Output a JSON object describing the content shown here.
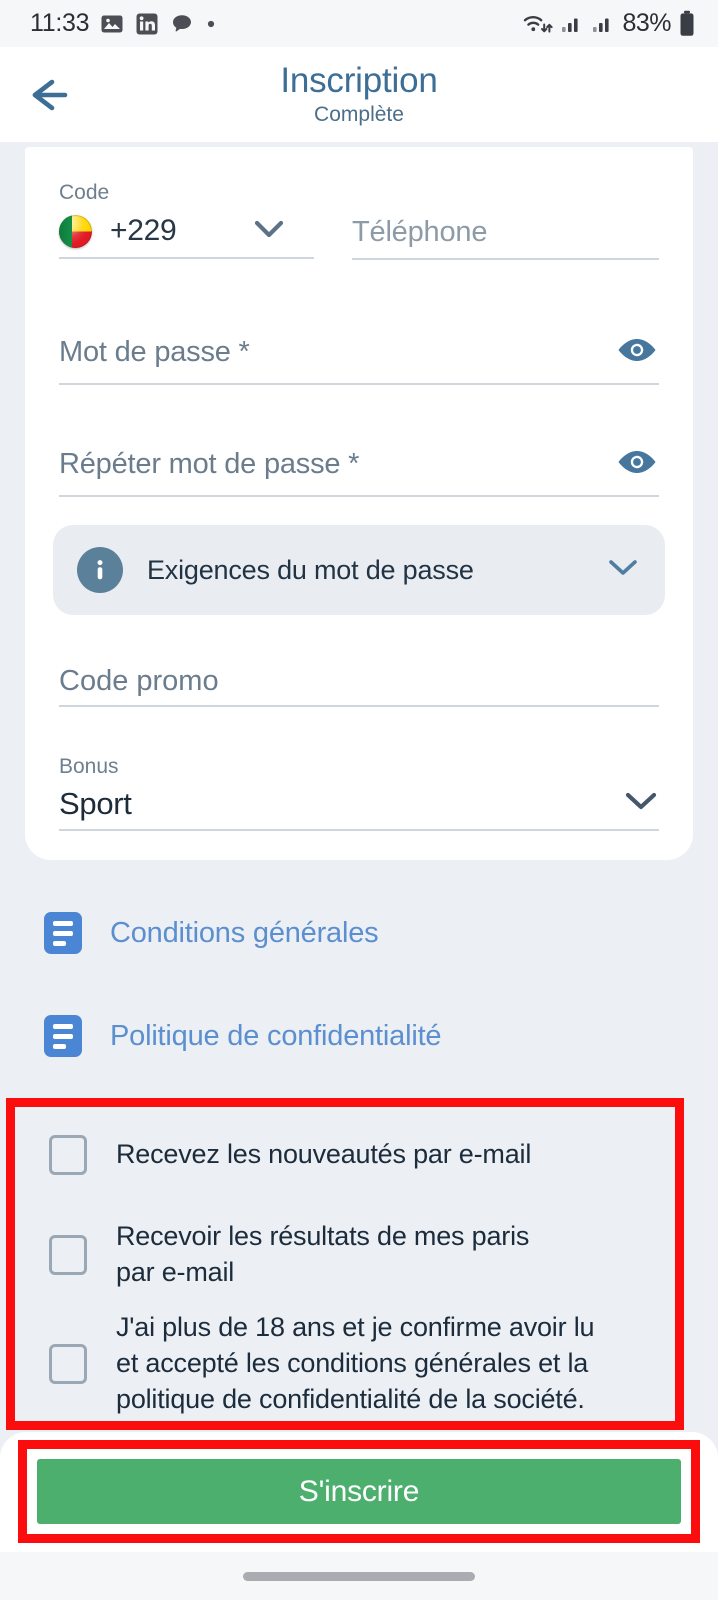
{
  "status_bar": {
    "time": "11:33",
    "battery_percent": "83%",
    "left_icons": [
      "image-icon",
      "linkedin-icon",
      "chat-bubble-icon",
      "dot-icon"
    ],
    "right_icons": [
      "wifi-icon",
      "signal-1-icon",
      "signal-2-icon",
      "battery-icon"
    ]
  },
  "header": {
    "back_icon": "arrow-left-icon",
    "title": "Inscription",
    "subtitle": "Complète",
    "title_color": "#3d6e96"
  },
  "form": {
    "country_code": {
      "label": "Code",
      "flag": "benin-flag-icon",
      "value": "+229",
      "chevron": "chevron-down-icon"
    },
    "phone": {
      "placeholder": "Téléphone",
      "value": ""
    },
    "password": {
      "placeholder": "Mot de passe *",
      "value": "",
      "toggle_icon": "eye-icon"
    },
    "password_repeat": {
      "placeholder": "Répéter mot de passe *",
      "value": "",
      "toggle_icon": "eye-icon"
    },
    "password_requirements": {
      "icon": "info-icon",
      "label": "Exigences du mot de passe",
      "chevron": "chevron-down-icon",
      "expanded": false
    },
    "promo_code": {
      "placeholder": "Code promo",
      "value": ""
    },
    "bonus": {
      "label": "Bonus",
      "value": "Sport",
      "chevron": "chevron-down-icon"
    }
  },
  "documents": [
    {
      "icon": "document-icon",
      "label": "Conditions générales"
    },
    {
      "icon": "document-icon",
      "label": "Politique de confidentialité"
    }
  ],
  "consents": [
    {
      "checked": false,
      "label": "Recevez les nouveautés par e-mail"
    },
    {
      "checked": false,
      "label": "Recevoir les résultats de mes paris par e-mail"
    },
    {
      "checked": false,
      "label": "J'ai plus de 18 ans et je confirme avoir lu et accepté les conditions générales et la politique de confidentialité de la société."
    }
  ],
  "submit": {
    "label": "S'inscrire",
    "color": "#4caf6d"
  },
  "highlight": {
    "color": "#fc0d0d"
  },
  "colors": {
    "page_background": "#eceff3",
    "card_background": "#ffffff",
    "link_blue": "#5b8fd0",
    "accent_blue": "#4a86d4",
    "text_dark": "#1c2c3c"
  }
}
